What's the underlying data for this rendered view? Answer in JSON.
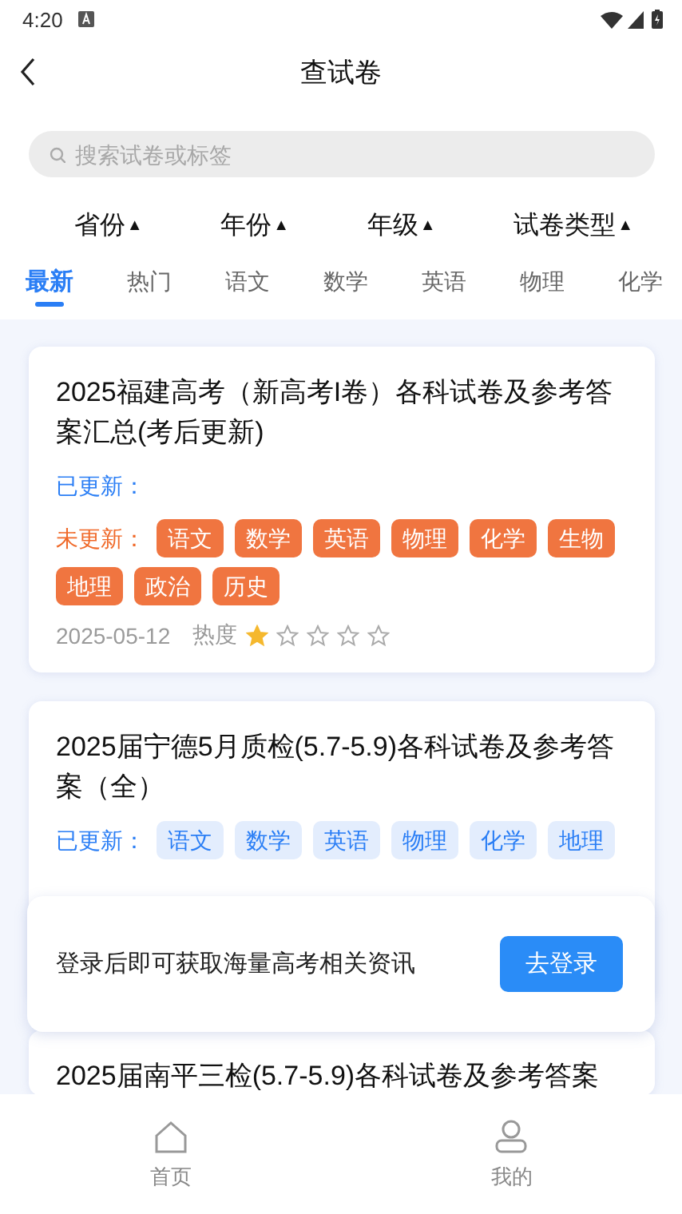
{
  "status_bar": {
    "time": "4:20"
  },
  "header": {
    "title": "查试卷"
  },
  "search": {
    "placeholder": "搜索试卷或标签"
  },
  "filters": [
    {
      "label": "省份",
      "arrow": "▲"
    },
    {
      "label": "年份",
      "arrow": "▲"
    },
    {
      "label": "年级",
      "arrow": "▲"
    },
    {
      "label": "试卷类型",
      "arrow": "▲"
    }
  ],
  "tabs": [
    {
      "label": "最新",
      "selected": true
    },
    {
      "label": "热门",
      "selected": false
    },
    {
      "label": "语文",
      "selected": false
    },
    {
      "label": "数学",
      "selected": false
    },
    {
      "label": "英语",
      "selected": false
    },
    {
      "label": "物理",
      "selected": false
    },
    {
      "label": "化学",
      "selected": false
    }
  ],
  "cards": [
    {
      "title": "2025福建高考（新高考I卷）各科试卷及参考答案汇总(考后更新)",
      "updated_label": "已更新：",
      "pending_label": "未更新：",
      "pending": [
        "语文",
        "数学",
        "英语",
        "物理",
        "化学",
        "生物",
        "地理",
        "政治",
        "历史"
      ],
      "date": "2025-05-12",
      "heat_label": "热度",
      "stars": 1
    },
    {
      "title": "2025届宁德5月质检(5.7-5.9)各科试卷及参考答案（全）",
      "updated_label": "已更新：",
      "updated": [
        "语文",
        "数学",
        "英语",
        "物理",
        "化学",
        "地理"
      ]
    },
    {
      "title": "2025届南平三检(5.7-5.9)各科试卷及参考答案"
    }
  ],
  "login_prompt": {
    "text": "登录后即可获取海量高考相关资讯",
    "button": "去登录"
  },
  "bottom_nav": [
    {
      "label": "首页",
      "kind": "home",
      "selected": false
    },
    {
      "label": "我的",
      "kind": "profile",
      "selected": false
    }
  ]
}
